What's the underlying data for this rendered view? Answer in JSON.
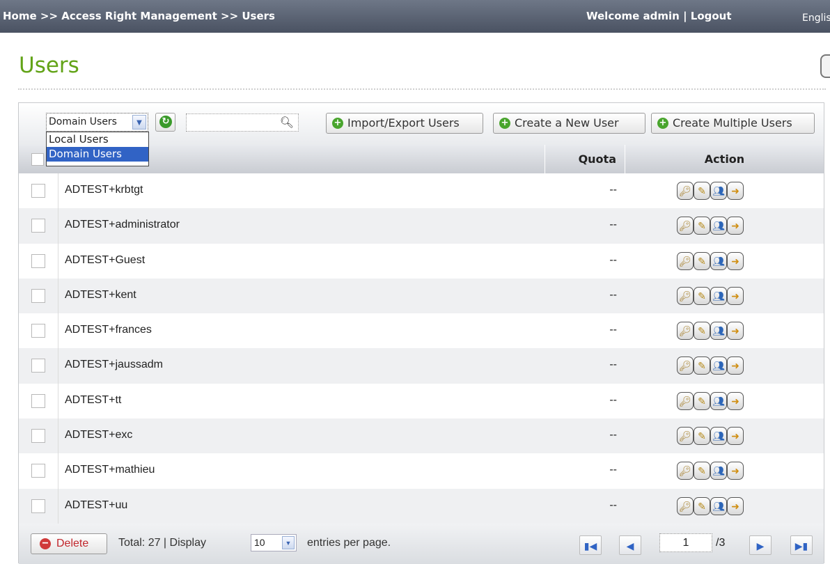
{
  "topbar": {
    "breadcrumb": "Home >> Access Right Management >> Users",
    "welcome": "Welcome admin | Logout",
    "language": "Englis"
  },
  "page": {
    "title": "Users"
  },
  "toolbar": {
    "user_type": {
      "selected": "Domain Users",
      "options": [
        "Local Users",
        "Domain Users"
      ]
    },
    "refresh_icon": "refresh-icon",
    "search": {
      "value": "",
      "icon": "search-icon"
    },
    "import_export_label": "Import/Export Users",
    "create_user_label": "Create a New User",
    "create_multiple_label": "Create Multiple Users"
  },
  "table": {
    "columns": {
      "quota": "Quota",
      "action": "Action"
    },
    "rows": [
      {
        "name": "ADTEST+krbtgt",
        "quota": "--"
      },
      {
        "name": "ADTEST+administrator",
        "quota": "--"
      },
      {
        "name": "ADTEST+Guest",
        "quota": "--"
      },
      {
        "name": "ADTEST+kent",
        "quota": "--"
      },
      {
        "name": "ADTEST+frances",
        "quota": "--"
      },
      {
        "name": "ADTEST+jaussadm",
        "quota": "--"
      },
      {
        "name": "ADTEST+tt",
        "quota": "--"
      },
      {
        "name": "ADTEST+exc",
        "quota": "--"
      },
      {
        "name": "ADTEST+mathieu",
        "quota": "--"
      },
      {
        "name": "ADTEST+uu",
        "quota": "--"
      }
    ],
    "action_icons": [
      "password-key-icon",
      "edit-icon",
      "user-group-icon",
      "shared-folder-icon"
    ]
  },
  "footer": {
    "delete_label": "Delete",
    "total_text": "Total:  27   |   Display",
    "per_page_value": "10",
    "per_page_suffix": "entries per page.",
    "current_page": "1",
    "total_pages": "/3"
  }
}
